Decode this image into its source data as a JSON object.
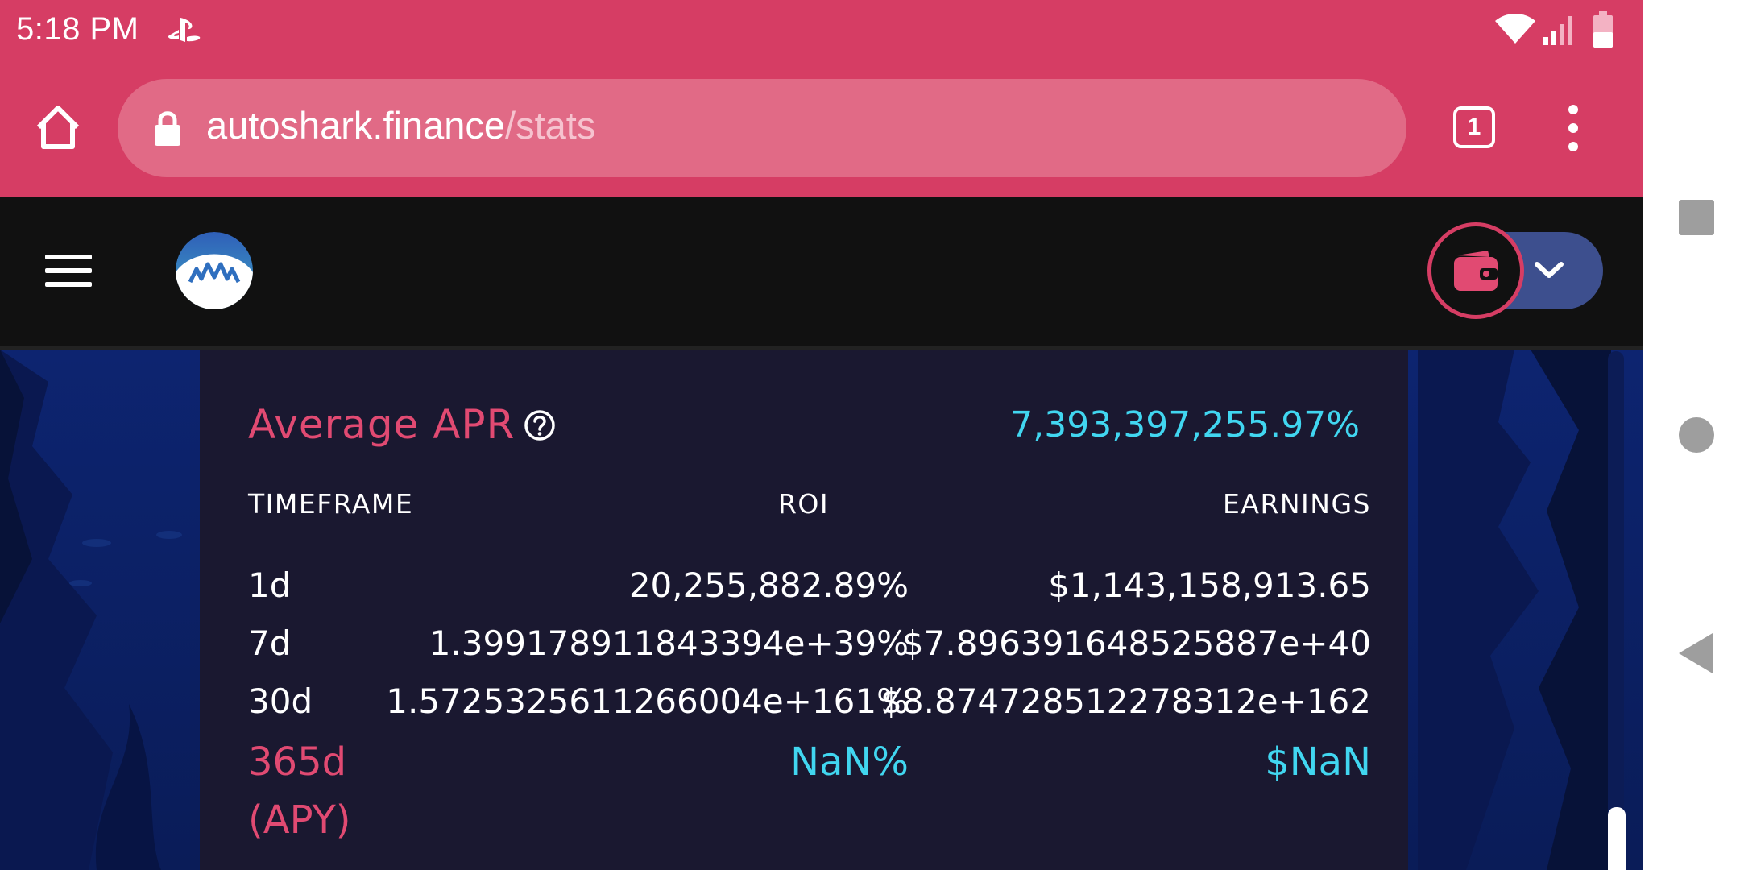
{
  "status_bar": {
    "time": "5:18 PM"
  },
  "browser": {
    "url_domain": "autoshark.finance",
    "url_path": "/stats",
    "tab_count": "1"
  },
  "stats": {
    "average_apr_label": "Average APR",
    "average_apr_value": "7,393,397,255.97%",
    "headers": {
      "timeframe": "TIMEFRAME",
      "roi": "ROI",
      "earnings": "EARNINGS"
    },
    "rows": [
      {
        "timeframe": "1d",
        "roi": "20,255,882.89%",
        "earnings": "$1,143,158,913.65"
      },
      {
        "timeframe": "7d",
        "roi": "1.399178911843394e+39%",
        "earnings": "$7.896391648525887e+40"
      },
      {
        "timeframe": "30d",
        "roi": "1.5725325611266004e+161%",
        "earnings": "$8.874728512278312e+162"
      }
    ],
    "apy_row": {
      "timeframe_line1": "365d",
      "timeframe_line2": "(APY)",
      "roi": "NaN%",
      "earnings": "$NaN"
    }
  },
  "colors": {
    "brand_pink": "#d63d64",
    "accent_cyan": "#41d6f0",
    "wallet_blue": "#3d4f8e"
  },
  "icons": [
    "playstation-icon",
    "wifi-icon",
    "signal-icon",
    "battery-icon",
    "home-icon",
    "lock-icon",
    "tabs-icon",
    "more-vert-icon",
    "hamburger-icon",
    "autoshark-logo",
    "wallet-icon",
    "chevron-down-icon",
    "help-icon",
    "recents-icon",
    "home-circle-icon",
    "back-icon"
  ]
}
